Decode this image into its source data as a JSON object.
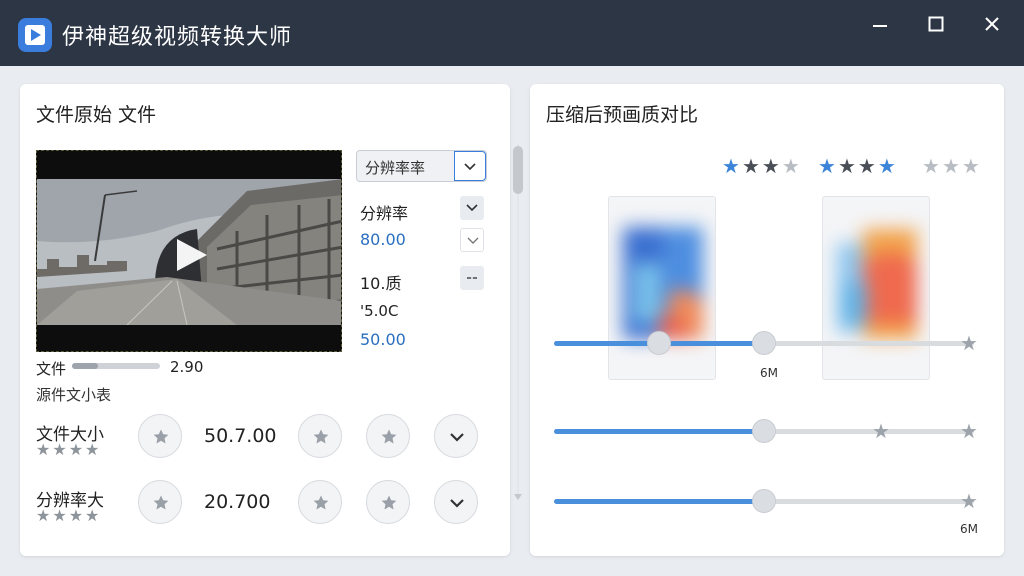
{
  "window": {
    "title": "伊神超级视频转换大师",
    "controls": {
      "minimize": "minimize",
      "maximize": "maximize",
      "close": "close"
    }
  },
  "left_panel": {
    "title": "文件原始 文件",
    "select": {
      "value": "分辨率率"
    },
    "labels": {
      "resolution": "分辨率",
      "resolution_value": "80.00",
      "quality": "10.质",
      "quality_value_raw": "'5.0C",
      "quality_value": "50.00"
    },
    "progress": {
      "label": "文件",
      "value_text": "2.90",
      "fraction": 0.3
    },
    "size_caption": "源件文小表",
    "rows": [
      {
        "label": "文件大小",
        "value": "50.7.00",
        "stars": 5
      },
      {
        "label": "分辨率大",
        "value": "20.700",
        "stars": 5
      }
    ]
  },
  "right_panel": {
    "title": "压缩后预画质对比",
    "rating_groups": [
      {
        "filled": 1,
        "dark": 2,
        "gray": 1
      },
      {
        "filled": 1,
        "dark": 2,
        "blue_end": 1
      },
      {
        "gray": 3
      }
    ],
    "sliders": [
      {
        "fill": 0.48,
        "knobs": [
          0.25,
          0.5
        ],
        "caption": "6M"
      },
      {
        "fill": 0.48,
        "knobs": [
          0.5
        ],
        "caption": ""
      },
      {
        "fill": 0.48,
        "knobs": [
          0.5
        ],
        "caption": "6M"
      }
    ]
  },
  "colors": {
    "titlebar": "#2d3645",
    "accent": "#3b7ddd",
    "blue_text": "#2a6fbf",
    "star_blue": "#3b84d8",
    "star_dark": "#4a4f57",
    "star_gray": "#b8bdc3"
  },
  "icons": [
    "play-icon",
    "chevron-down-icon",
    "star-icon",
    "minimize-icon",
    "maximize-icon",
    "close-icon",
    "swap-icon"
  ]
}
